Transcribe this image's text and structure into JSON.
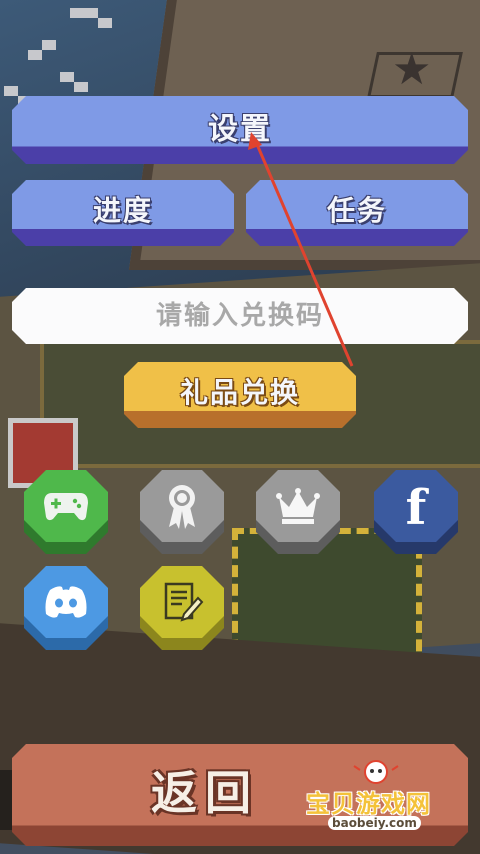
{
  "menu": {
    "settings_label": "设置",
    "progress_label": "进度",
    "tasks_label": "任务",
    "redeem_placeholder": "请输入兑换码",
    "redeem_value": "",
    "redeem_button_label": "礼品兑换",
    "back_label": "返回"
  },
  "icons": [
    {
      "name": "gamepad-icon",
      "color": "#4fb84b"
    },
    {
      "name": "award-ribbon-icon",
      "color": "#9a9a9a"
    },
    {
      "name": "crown-icon",
      "color": "#9a9a9a"
    },
    {
      "name": "facebook-icon",
      "color": "#3b5a9f"
    },
    {
      "name": "discord-icon",
      "color": "#4d99e3"
    },
    {
      "name": "notes-edit-icon",
      "color": "#c8c12e"
    }
  ],
  "watermark": {
    "text": "宝贝游戏网",
    "url": "baobeiy.com"
  },
  "colors": {
    "primary_button": "#7f9ae6",
    "gold_button": "#f0c048",
    "back_button": "#c4725a",
    "annotation_arrow": "#e0432f"
  }
}
